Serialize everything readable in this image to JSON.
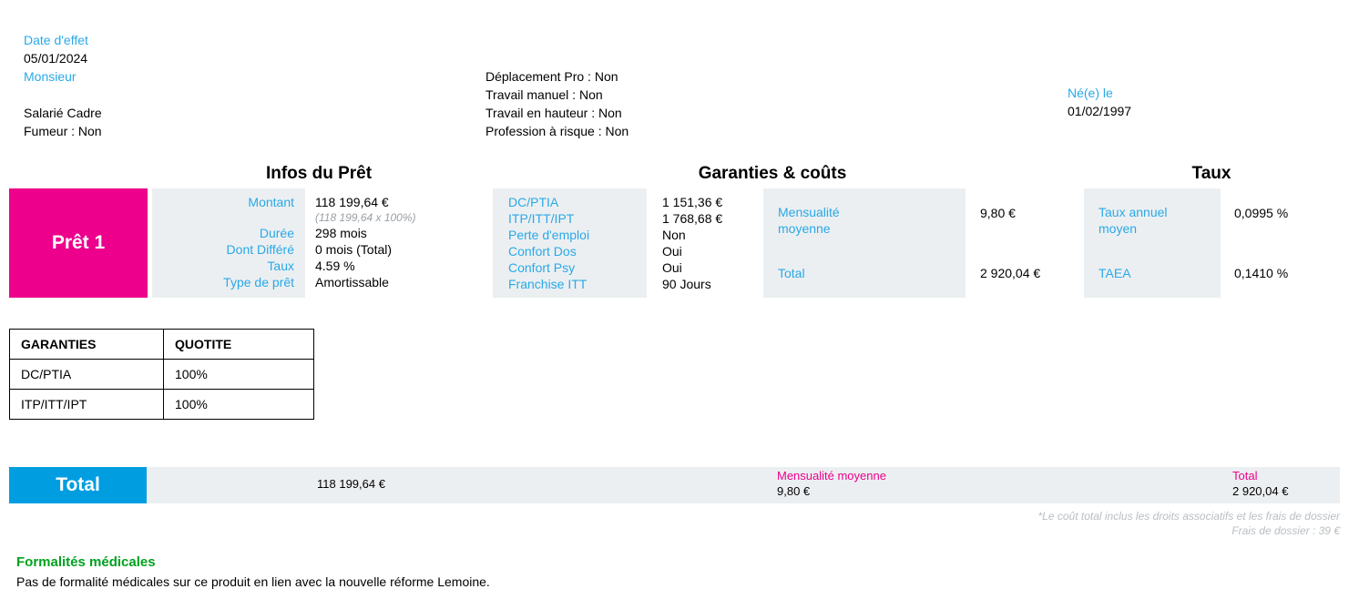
{
  "header": {
    "left": {
      "date_label": "Date d'effet",
      "date_value": "05/01/2024",
      "civility": "Monsieur",
      "status": "Salarié Cadre",
      "smoker": "Fumeur : Non"
    },
    "middle": {
      "lines": [
        "Déplacement Pro : Non",
        "Travail manuel : Non",
        "Travail en hauteur : Non",
        "Profession à risque : Non"
      ]
    },
    "right": {
      "birth_label": "Né(e) le",
      "birth_value": "01/02/1997"
    }
  },
  "sections": {
    "loan_title": "Infos du Prêt",
    "guarantees_title": "Garanties & coûts",
    "rates_title": "Taux"
  },
  "loan": {
    "badge": "Prêt 1",
    "info": [
      {
        "label": "Montant",
        "value": "118 199,64 €",
        "sub": "(118 199,64 x 100%)"
      },
      {
        "label": "Durée",
        "value": "298 mois",
        "sub": ""
      },
      {
        "label": "Dont Différé",
        "value": "0 mois (Total)",
        "sub": ""
      },
      {
        "label": "Taux",
        "value": "4.59 %",
        "sub": ""
      },
      {
        "label": "Type de prêt",
        "value": "Amortissable",
        "sub": ""
      }
    ],
    "guarantees": [
      {
        "label": "DC/PTIA",
        "value": "1 151,36 €"
      },
      {
        "label": "ITP/ITT/IPT",
        "value": "1 768,68 €"
      },
      {
        "label": "Perte d'emploi",
        "value": "Non"
      },
      {
        "label": "Confort Dos",
        "value": "Oui"
      },
      {
        "label": "Confort Psy",
        "value": "Oui"
      },
      {
        "label": "Franchise ITT",
        "value": "90 Jours"
      }
    ],
    "costs": [
      {
        "label": "Mensualité moyenne",
        "label_l1": "Mensualité",
        "label_l2": "moyenne",
        "value": "9,80 €"
      },
      {
        "label": "Total",
        "label_l1": "Total",
        "label_l2": "",
        "value": "2 920,04 €"
      }
    ],
    "rates": [
      {
        "label_l1": "Taux annuel",
        "label_l2": "moyen",
        "value": "0,0995 %"
      },
      {
        "label_l1": "TAEA",
        "label_l2": "",
        "value": "0,1410 %"
      }
    ]
  },
  "quotite_table": {
    "headers": [
      "GARANTIES",
      "QUOTITE"
    ],
    "rows": [
      [
        "DC/PTIA",
        "100%"
      ],
      [
        "ITP/ITT/IPT",
        "100%"
      ]
    ]
  },
  "total": {
    "badge": "Total",
    "amount": "118 199,64 €",
    "monthly_label": "Mensualité moyenne",
    "monthly_value": "9,80 €",
    "total_label": "Total",
    "total_value": "2 920,04 €",
    "footnote_1": "*Le coût total inclus les droits associatifs et les frais de dossier",
    "footnote_2": "Frais de dossier : 39 €"
  },
  "formalites": {
    "title": "Formalités médicales",
    "text": "Pas de formalité médicales sur ce produit en lien avec la nouvelle réforme Lemoine."
  },
  "colors": {
    "magenta": "#ec008c",
    "blue": "#009ee0",
    "link_blue": "#29a9e8",
    "green": "#00a21e",
    "panel_grey": "#eceff1"
  }
}
